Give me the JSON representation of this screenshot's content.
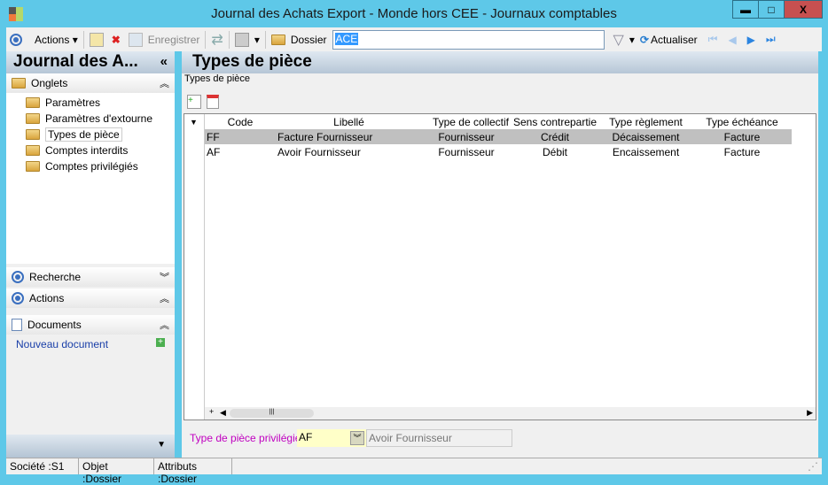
{
  "window": {
    "title": "Journal  des  Achats Export  -  Monde  hors CEE  -  Journaux comptables",
    "minimize": "▬",
    "maximize": "□",
    "close": "X"
  },
  "toolbar": {
    "actions": "Actions",
    "save": "Enregistrer",
    "dossier_label": "Dossier",
    "dossier_value": "ACE",
    "refresh": "Actualiser"
  },
  "left": {
    "title": "Journal  des  A...",
    "collapse": "«",
    "onglets": "Onglets",
    "tree": [
      "Paramètres",
      "Paramètres d'extourne",
      "Types de pièce",
      "Comptes interdits",
      "Comptes privilégiés"
    ],
    "recherche": "Recherche",
    "actions": "Actions",
    "documents": "Documents",
    "new_document": "Nouveau document"
  },
  "main": {
    "title": "Types de pièce",
    "group_label": "Types de pièce",
    "columns": [
      "Code",
      "Libellé",
      "Type de collectif",
      "Sens contrepartie",
      "Type règlement",
      "Type échéance"
    ],
    "rows": [
      [
        "FF",
        "Facture Fournisseur",
        "Fournisseur",
        "Crédit",
        "Décaissement",
        "Facture"
      ],
      [
        "AF",
        "Avoir Fournisseur",
        "Fournisseur",
        "Débit",
        "Encaissement",
        "Facture"
      ]
    ],
    "privileged_label": "Type de pièce privilégié",
    "privileged_code": "AF",
    "privileged_name": "Avoir Fournisseur"
  },
  "status": [
    "Société :S1",
    "Objet :Dossier",
    "Attributs :Dossier"
  ]
}
